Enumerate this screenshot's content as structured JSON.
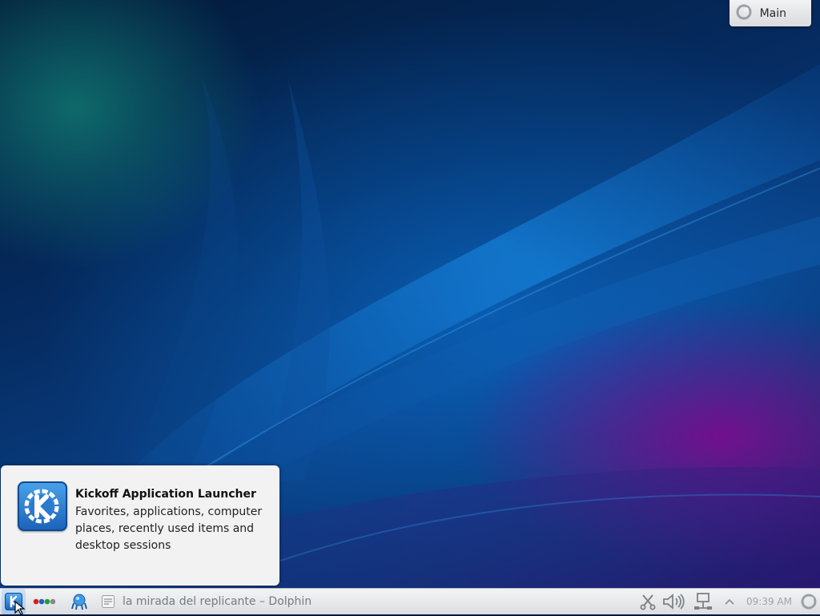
{
  "activity": {
    "label": "Main",
    "icon": "plasma-activity-icon"
  },
  "tooltip": {
    "title": "Kickoff Application Launcher",
    "description": "Favorites, applications, computer places, recently used items and desktop sessions",
    "icon": "kde-logo-icon"
  },
  "taskbar": {
    "launcher_icon": "kde-logo-icon",
    "pager_icon": "activity-dots-icon",
    "pager_dot_colors": [
      "#d42020",
      "#2060c8",
      "#22a030",
      "#888888"
    ],
    "browser_icon": "konqueror-icon",
    "task": {
      "icon": "dolphin-file-manager-icon",
      "label": "la mirada del replicante – Dolphin"
    },
    "tray": {
      "icons": [
        "klipper-scissors-icon",
        "speaker-volume-icon",
        "network-icon",
        "expand-tray-arrow-icon"
      ],
      "clock": "09:39 AM",
      "cashew_icon": "plasma-cashew-icon"
    }
  },
  "colors": {
    "panel": "#e6e8ea",
    "accent": "#1b62b8"
  }
}
